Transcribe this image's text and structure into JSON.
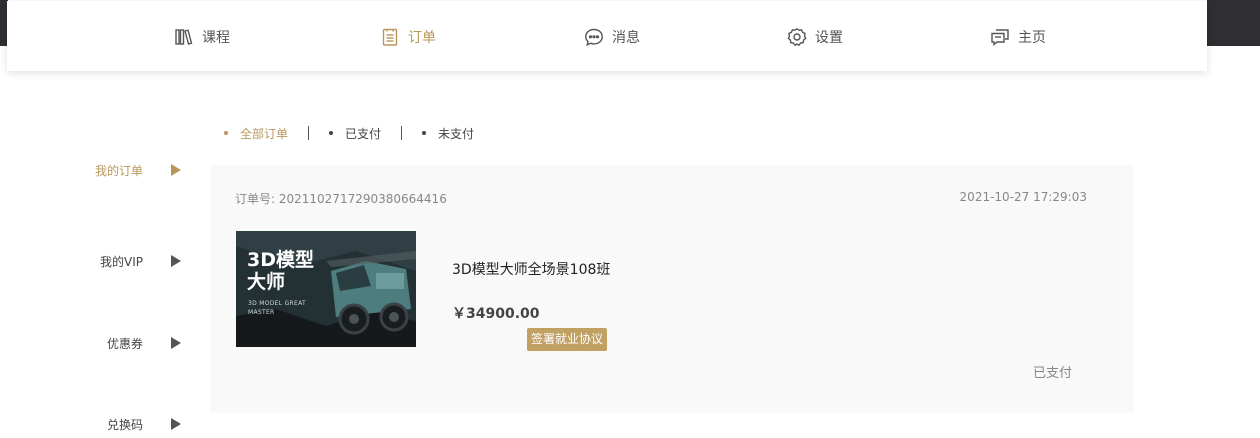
{
  "nav": {
    "items": [
      {
        "label": "课程",
        "icon": "books-icon"
      },
      {
        "label": "订单",
        "icon": "clipboard-icon"
      },
      {
        "label": "消息",
        "icon": "chat-bubble-icon"
      },
      {
        "label": "设置",
        "icon": "gear-icon"
      },
      {
        "label": "主页",
        "icon": "home-chat-icon"
      }
    ],
    "active_index": 1
  },
  "sidebar": {
    "items": [
      {
        "label": "我的订单"
      },
      {
        "label": "我的VIP"
      },
      {
        "label": "优惠券"
      },
      {
        "label": "兑换码"
      }
    ],
    "active_index": 0
  },
  "filters": {
    "items": [
      {
        "label": "全部订单"
      },
      {
        "label": "已支付"
      },
      {
        "label": "未支付"
      }
    ],
    "active_index": 0
  },
  "order": {
    "number_label": "订单号: ",
    "number": "20211027172903806644​16",
    "time": "2021-10-27 17:29:03",
    "thumbnail": {
      "title_line1": "3D模型",
      "title_line2": "大师",
      "subtitle": "3D MODEL GREAT MASTER"
    },
    "course_title": "3D模型大师全场景108班",
    "price": "￥34900.00",
    "sign_button": "签署就业协议",
    "status": "已支付"
  },
  "colors": {
    "accent": "#b9975b",
    "button": "#c1a064",
    "card_bg": "#f9f9f9"
  }
}
